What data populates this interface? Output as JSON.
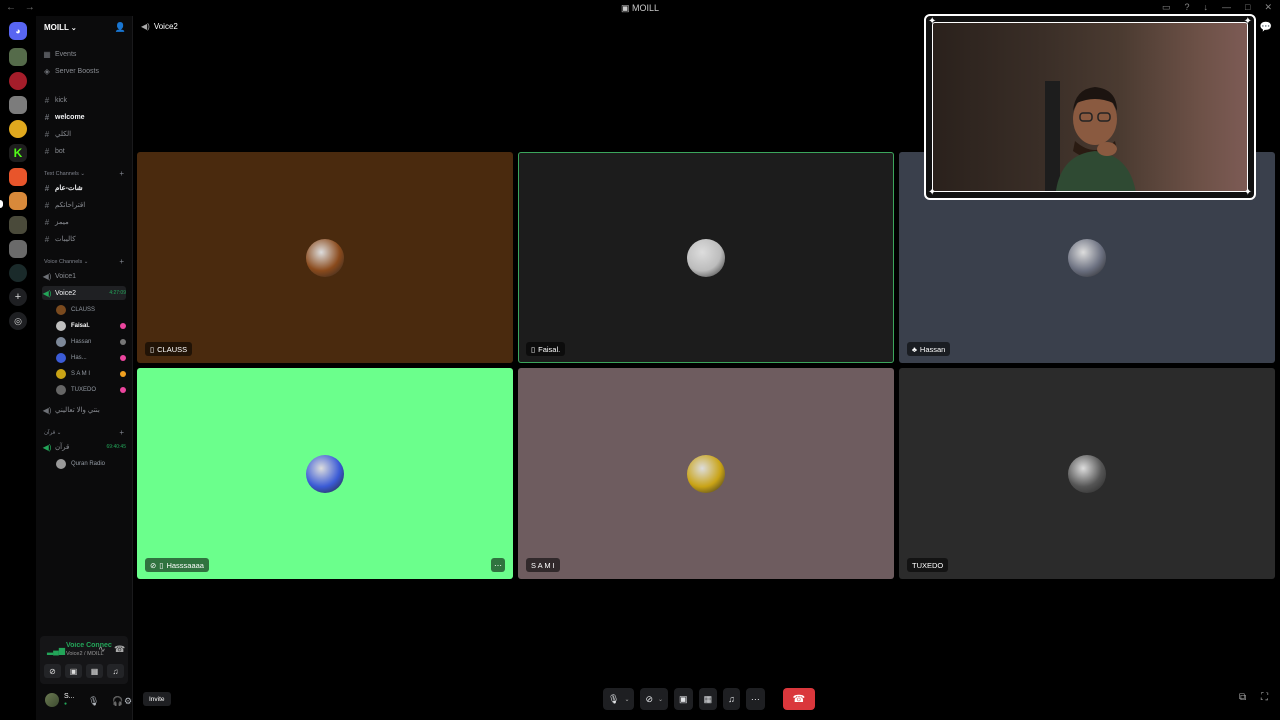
{
  "titlebar": {
    "title": "MOILL"
  },
  "server": {
    "name": "MOILL"
  },
  "sidebar": {
    "top_items": [
      {
        "icon": "calendar-icon",
        "label": "Events"
      },
      {
        "icon": "boost-icon",
        "label": "Server Boosts"
      }
    ],
    "channels_ungrouped": [
      "kick",
      "welcome",
      "الكلي",
      "bot"
    ],
    "text_category": "Text Channels",
    "text_channels": [
      "شات-عام",
      "اقتراحاتكم",
      "ميمز",
      "كاليبات"
    ],
    "voice_category": "Voice Channels",
    "voice_channels": [
      "Voice1",
      "Voice2"
    ],
    "voice2_timer": "4:27:09",
    "voice_members": [
      {
        "name": "CLAUSS",
        "color": "#7a4a1e"
      },
      {
        "name": "Faisal.",
        "color": "#bfbfbf"
      },
      {
        "name": "Hassan",
        "color": "#7d8899"
      },
      {
        "name": "Has...",
        "color": "#3b5bd6"
      },
      {
        "name": "S A M I",
        "color": "#c9a315"
      },
      {
        "name": "TUXEDO",
        "color": "#666666"
      }
    ],
    "afk_channel": "بنتي والا تعاليني",
    "quran_category": "قرآن",
    "quran_channel": "قرآن",
    "quran_timer": "69:40:45",
    "quran_member": "Quran Radio"
  },
  "voice_panel": {
    "title": "Voice Connecte",
    "subtitle": "Voice2 / MOILL"
  },
  "user": {
    "name": "S...",
    "status": "●"
  },
  "header": {
    "channel": "Voice2"
  },
  "tiles": [
    {
      "name": "CLAUSS",
      "bg": "#4a2a0e",
      "avatar": "#8a4a1c"
    },
    {
      "name": "Faisal.",
      "bg": "#1c1c1c",
      "avatar": "#bcbcbc"
    },
    {
      "name": "Hassan",
      "bg": "#3a404c",
      "avatar": "#6b7080"
    },
    {
      "name": "Hasssaaaa",
      "bg": "#6bff8c",
      "avatar": "#3b5bd6"
    },
    {
      "name": "S A M I",
      "bg": "#6e5c5f",
      "avatar": "#c9a315"
    },
    {
      "name": "TUXEDO",
      "bg": "#2b2b2b",
      "avatar": "#555555"
    }
  ],
  "controls": {
    "invite": "Invite"
  }
}
